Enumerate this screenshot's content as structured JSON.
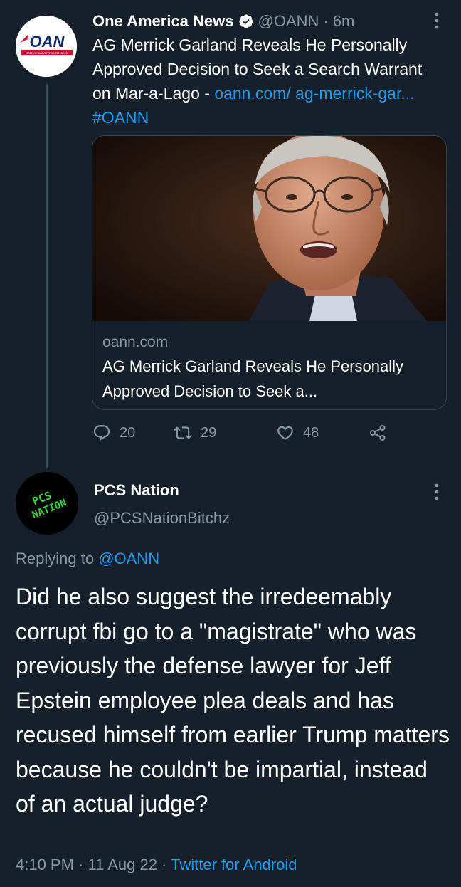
{
  "colors": {
    "background": "#15202b",
    "text_primary": "#ffffff",
    "text_secondary": "#8899a6",
    "link": "#1d9bf0",
    "verified_badge": "#ffffff"
  },
  "tweet1": {
    "author_name": "One America News",
    "verified_icon": "verified-badge-icon",
    "handle": "@OANN",
    "separator": "·",
    "time": "6m",
    "more_icon": "more-vertical-icon",
    "avatar_logo_text": "OAN",
    "avatar_logo_subtext": "One America News Network",
    "text_main": "AG Merrick Garland Reveals He Personally Approved Decision to Seek a Search Warrant on Mar-a-Lago - ",
    "text_link": "oann.com/ ag-merrick-gar...",
    "text_hashtag": "#OANN",
    "card": {
      "domain": "oann.com",
      "title": "AG Merrick Garland Reveals He Personally Approved Decision to Seek a..."
    },
    "actions": {
      "reply_icon": "reply-icon",
      "reply_count": "20",
      "retweet_icon": "retweet-icon",
      "retweet_count": "29",
      "like_icon": "heart-icon",
      "like_count": "48",
      "share_icon": "share-icon"
    }
  },
  "tweet2": {
    "avatar_text_line1": "PCS",
    "avatar_text_line2": "NATION",
    "author_name": "PCS Nation",
    "handle": "@PCSNationBitchz",
    "more_icon": "more-vertical-icon",
    "replying_prefix": "Replying to ",
    "replying_to": "@OANN",
    "text": "Did he also suggest the irredeemably corrupt fbi go to a \"magistrate\" who was previously the defense lawyer for Jeff Epstein employee plea deals and has recused himself from earlier Trump matters because he couldn't be impartial, instead of an actual judge?",
    "time": "4:10 PM",
    "separator": "·",
    "date": "11 Aug 22",
    "client": "Twitter for Android"
  }
}
